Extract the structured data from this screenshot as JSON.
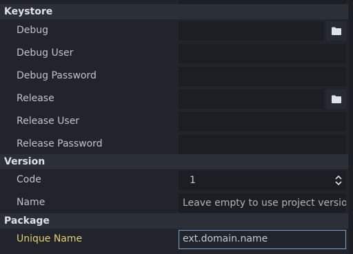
{
  "sections": {
    "keystore": "Keystore",
    "version": "Version",
    "package": "Package"
  },
  "keystore": {
    "debug_label": "Debug",
    "debug_value": "",
    "debug_user_label": "Debug User",
    "debug_user_value": "",
    "debug_password_label": "Debug Password",
    "debug_password_value": "",
    "release_label": "Release",
    "release_value": "",
    "release_user_label": "Release User",
    "release_user_value": "",
    "release_password_label": "Release Password",
    "release_password_value": ""
  },
  "version": {
    "code_label": "Code",
    "code_value": "1",
    "name_label": "Name",
    "name_placeholder": "Leave empty to use project version"
  },
  "package": {
    "unique_name_label": "Unique Name",
    "unique_name_value": "ext.domain.name"
  },
  "icons": {
    "folder": "folder-icon",
    "spinner": "spinner-updown-icon"
  },
  "colors": {
    "section_bg": "#2b2f36",
    "field_bg": "#1b1f24",
    "focus_border": "#7aa6d8",
    "highlight_label": "#e4d26a"
  }
}
